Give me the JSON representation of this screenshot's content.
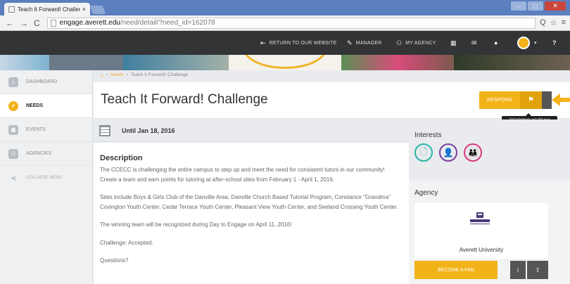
{
  "browser": {
    "tab_title": "Teach It Forward! Challen",
    "tab_close": "×",
    "nav_back": "←",
    "nav_forward": "→",
    "nav_reload": "C",
    "url_host": "engage.averett.edu",
    "url_path": "/need/detail/?need_id=162078",
    "zoom_icon": "Q",
    "star_icon": "☆",
    "menu_icon": "≡",
    "win_minimize": "–",
    "win_maximize": "□",
    "win_close": "✕"
  },
  "topnav": {
    "return_label": "RETURN TO OUR WEBSITE",
    "manager_label": "MANAGER",
    "agency_label": "MY AGENCY",
    "help_icon": "?",
    "caret": "▾",
    "return_icon": "⇤",
    "manager_icon": "✎",
    "agency_icon": "⚇",
    "grid_icon": "▦",
    "mail_icon": "✉",
    "bell_icon": "●"
  },
  "sidebar": {
    "items": [
      {
        "label": "DASHBOARD",
        "icon": "⌂"
      },
      {
        "label": "NEEDS",
        "icon": "✓"
      },
      {
        "label": "EVENTS",
        "icon": "▦"
      },
      {
        "label": "AGENCIES",
        "icon": "⚇"
      }
    ],
    "collapse_label": "COLLAPSE MENU",
    "collapse_icon": "◂|"
  },
  "breadcrumb": {
    "home_icon": "⌂",
    "sep1": "›",
    "needs": "Needs",
    "sep2": "›",
    "current": "Teach It Forward! Challenge"
  },
  "need": {
    "title": "Teach It Forward! Challenge",
    "respond_label": "RESPOND",
    "respond_team_icon": "⚑",
    "tooltip": "RESPOND AS TEAM",
    "until": "Until  Jan 18, 2016",
    "description_head": "Description",
    "paragraphs": [
      "The CCECC is challenging the entire campus to step up and meet the need for consistent tutors in our community! Create a team and earn points for tutoring at after-school sites from February 1 - April 1, 2016.",
      "Sites include Boys & Girls Club of the Danville Area, Danville Church Based Tutorial Program, Constance \"Grandma\" Covington Youth Center, Cedar Terrace Youth Center, Pleasant View Youth Center, and Seeland Crossing Youth Center.",
      "The winning team will be recognized during Day to Engage on April 11, 2016!",
      "Challenge: Accepted.",
      "Questions?"
    ]
  },
  "interests": {
    "head": "Interests",
    "items": [
      {
        "icon": "🗋",
        "color": "#28b6a6"
      },
      {
        "icon": "👤",
        "color": "#7b3fa0"
      },
      {
        "icon": "👪",
        "color": "#d63a7e"
      }
    ]
  },
  "agency": {
    "head": "Agency",
    "name": "Averett University",
    "fan_label": "BECOME A FAN",
    "info_icon": "i",
    "share_icon": "⇪"
  },
  "colors": {
    "accent": "#f2b319",
    "dark_nav": "#323436"
  }
}
